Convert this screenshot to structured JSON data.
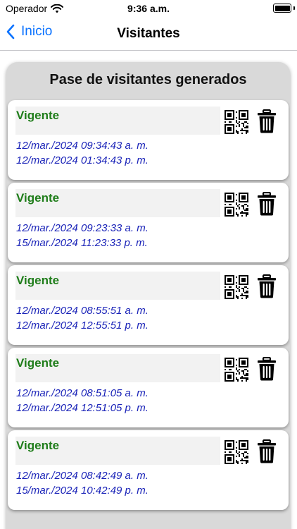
{
  "status_bar": {
    "carrier": "Operador",
    "time": "9:36 a.m."
  },
  "nav": {
    "back_label": "Inicio",
    "title": "Visitantes"
  },
  "panel": {
    "title": "Pase de visitantes generados"
  },
  "passes": [
    {
      "status": "Vigente",
      "start": "12/mar./2024 09:34:43 a. m.",
      "end": "12/mar./2024 01:34:43 p. m."
    },
    {
      "status": "Vigente",
      "start": "12/mar./2024 09:23:33 a. m.",
      "end": "15/mar./2024 11:23:33 p. m."
    },
    {
      "status": "Vigente",
      "start": "12/mar./2024 08:55:51 a. m.",
      "end": "12/mar./2024 12:55:51 p. m."
    },
    {
      "status": "Vigente",
      "start": "12/mar./2024 08:51:05 a. m.",
      "end": "12/mar./2024 12:51:05 p. m."
    },
    {
      "status": "Vigente",
      "start": "12/mar./2024 08:42:49 a. m.",
      "end": "15/mar./2024 10:42:49 p. m."
    }
  ],
  "colors": {
    "accent": "#0a72ff",
    "status_active": "#1f7d1a",
    "date_text": "#1a23b8",
    "panel_bg": "#d9d9d9"
  },
  "icons": {
    "card_primary": "qr-code-icon",
    "card_secondary": "trash-icon"
  }
}
